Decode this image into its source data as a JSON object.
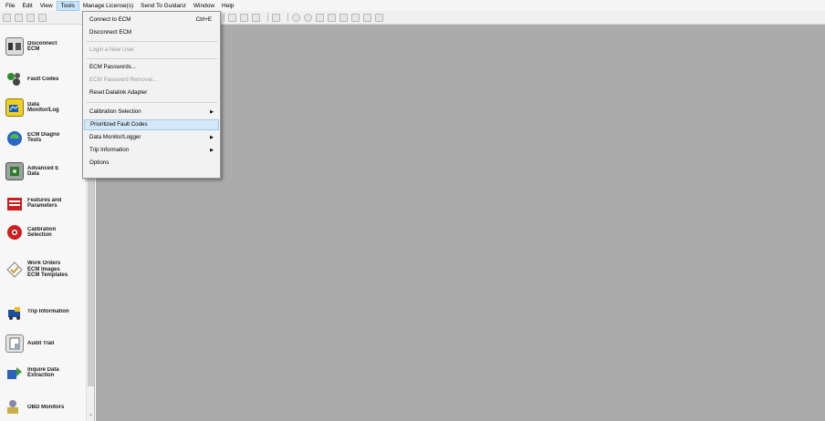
{
  "menubar": {
    "items": [
      {
        "label": "File"
      },
      {
        "label": "Edit"
      },
      {
        "label": "View"
      },
      {
        "label": "Tools"
      },
      {
        "label": "Manage License(s)"
      },
      {
        "label": "Send To Guidanz"
      },
      {
        "label": "Window"
      },
      {
        "label": "Help"
      }
    ],
    "active": "Tools"
  },
  "tools_menu": {
    "items": [
      {
        "label": "Connect to ECM",
        "shortcut": "Ctrl+E",
        "enabled": true
      },
      {
        "label": "Disconnect ECM",
        "enabled": true
      },
      {
        "label": "Login a New User",
        "enabled": false
      },
      {
        "label": "ECM Passwords...",
        "enabled": true
      },
      {
        "label": "ECM Password Removal...",
        "enabled": false
      },
      {
        "label": "Reset Datalink Adapter",
        "enabled": true
      },
      {
        "label": "Calibration Selection",
        "submenu": true,
        "enabled": true
      },
      {
        "label": "Prioritized Fault Codes",
        "enabled": true,
        "highlighted": true
      },
      {
        "label": "Data Monitor/Logger",
        "submenu": true,
        "enabled": true
      },
      {
        "label": "Trip Information",
        "submenu": true,
        "enabled": true
      },
      {
        "label": "Options",
        "enabled": true
      }
    ]
  },
  "sidebar": {
    "items": [
      {
        "label": "Disconnect\nECM",
        "icon": "disconnect-icon"
      },
      {
        "label": "Fault Codes",
        "icon": "fault-codes-icon"
      },
      {
        "label": "Data\nMonitor/Log",
        "icon": "data-monitor-icon"
      },
      {
        "label": "ECM Diagno\nTests",
        "icon": "ecm-diagnostic-tests-icon"
      },
      {
        "label": "Advanced E\nData",
        "icon": "advanced-ecm-data-icon"
      },
      {
        "label": "Features and\nParameters",
        "icon": "features-parameters-icon"
      },
      {
        "label": "Calibration\nSelection",
        "icon": "calibration-selection-icon"
      },
      {
        "label": "Work Orders\nECM Images\nECM Templates",
        "icon": "work-orders-icon"
      },
      {
        "label": "Trip Information",
        "icon": "trip-information-icon"
      },
      {
        "label": "Audit Trail",
        "icon": "audit-trail-icon"
      },
      {
        "label": "Inquire Data\nExtraction",
        "icon": "inquire-data-extraction-icon"
      },
      {
        "label": "OBD Monitors",
        "icon": "obd-monitors-icon"
      }
    ]
  },
  "colors": {
    "workspace": "#ababab",
    "menu_highlight": "#d5e8f8",
    "sidebar_bg": "#f7f7f7"
  }
}
